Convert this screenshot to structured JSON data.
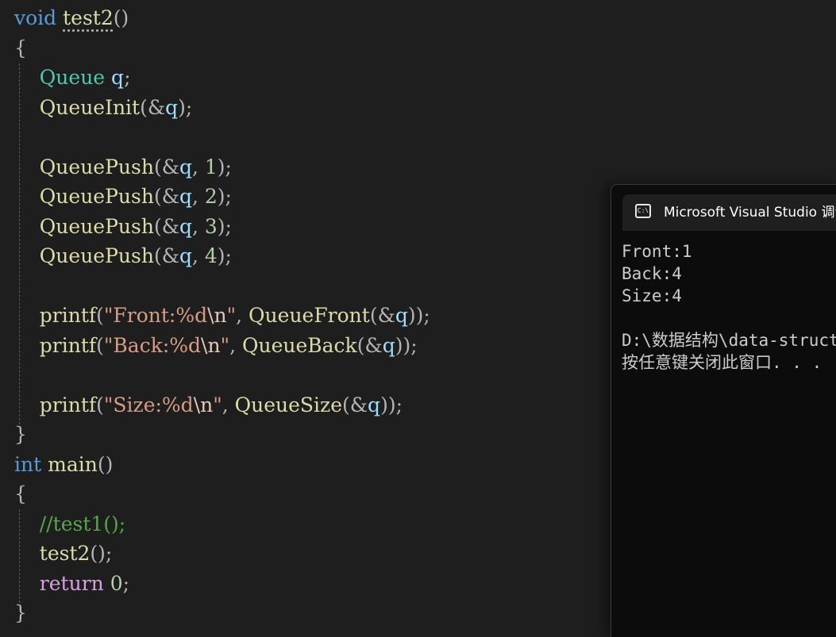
{
  "editor": {
    "lines": [
      {
        "tokens": [
          [
            "kw",
            "void"
          ],
          [
            "plain",
            " "
          ],
          [
            "fn squiggle",
            "test2"
          ],
          [
            "pun",
            "()"
          ]
        ]
      },
      {
        "tokens": [
          [
            "pun",
            "{"
          ]
        ]
      },
      {
        "tokens": [
          [
            "plain",
            "    "
          ],
          [
            "type",
            "Queue"
          ],
          [
            "plain",
            " "
          ],
          [
            "var",
            "q"
          ],
          [
            "pun",
            ";"
          ]
        ]
      },
      {
        "tokens": [
          [
            "plain",
            "    "
          ],
          [
            "fn",
            "QueueInit"
          ],
          [
            "pun",
            "(&"
          ],
          [
            "var",
            "q"
          ],
          [
            "pun",
            ");"
          ]
        ]
      },
      {
        "tokens": []
      },
      {
        "tokens": [
          [
            "plain",
            "    "
          ],
          [
            "fn",
            "QueuePush"
          ],
          [
            "pun",
            "(&"
          ],
          [
            "var",
            "q"
          ],
          [
            "pun",
            ", "
          ],
          [
            "num",
            "1"
          ],
          [
            "pun",
            ");"
          ]
        ]
      },
      {
        "tokens": [
          [
            "plain",
            "    "
          ],
          [
            "fn",
            "QueuePush"
          ],
          [
            "pun",
            "(&"
          ],
          [
            "var",
            "q"
          ],
          [
            "pun",
            ", "
          ],
          [
            "num",
            "2"
          ],
          [
            "pun",
            ");"
          ]
        ]
      },
      {
        "tokens": [
          [
            "plain",
            "    "
          ],
          [
            "fn",
            "QueuePush"
          ],
          [
            "pun",
            "(&"
          ],
          [
            "var",
            "q"
          ],
          [
            "pun",
            ", "
          ],
          [
            "num",
            "3"
          ],
          [
            "pun",
            ");"
          ]
        ]
      },
      {
        "tokens": [
          [
            "plain",
            "    "
          ],
          [
            "fn",
            "QueuePush"
          ],
          [
            "pun",
            "(&"
          ],
          [
            "var",
            "q"
          ],
          [
            "pun",
            ", "
          ],
          [
            "num",
            "4"
          ],
          [
            "pun",
            ");"
          ]
        ]
      },
      {
        "tokens": []
      },
      {
        "tokens": [
          [
            "plain",
            "    "
          ],
          [
            "fn",
            "printf"
          ],
          [
            "pun",
            "("
          ],
          [
            "str",
            "\"Front:%d"
          ],
          [
            "esc",
            "\\n"
          ],
          [
            "str",
            "\""
          ],
          [
            "pun",
            ", "
          ],
          [
            "fn",
            "QueueFront"
          ],
          [
            "pun",
            "(&"
          ],
          [
            "var",
            "q"
          ],
          [
            "pun",
            "));"
          ]
        ]
      },
      {
        "tokens": [
          [
            "plain",
            "    "
          ],
          [
            "fn",
            "printf"
          ],
          [
            "pun",
            "("
          ],
          [
            "str",
            "\"Back:%d"
          ],
          [
            "esc",
            "\\n"
          ],
          [
            "str",
            "\""
          ],
          [
            "pun",
            ", "
          ],
          [
            "fn",
            "QueueBack"
          ],
          [
            "pun",
            "(&"
          ],
          [
            "var",
            "q"
          ],
          [
            "pun",
            "));"
          ]
        ]
      },
      {
        "tokens": []
      },
      {
        "tokens": [
          [
            "plain",
            "    "
          ],
          [
            "fn",
            "printf"
          ],
          [
            "pun",
            "("
          ],
          [
            "str",
            "\"Size:%d"
          ],
          [
            "esc",
            "\\n"
          ],
          [
            "str",
            "\""
          ],
          [
            "pun",
            ", "
          ],
          [
            "fn",
            "QueueSize"
          ],
          [
            "pun",
            "(&"
          ],
          [
            "var",
            "q"
          ],
          [
            "pun",
            "));"
          ]
        ]
      },
      {
        "tokens": [
          [
            "pun",
            "}"
          ]
        ]
      },
      {
        "tokens": [
          [
            "kw",
            "int"
          ],
          [
            "plain",
            " "
          ],
          [
            "fn",
            "main"
          ],
          [
            "pun",
            "()"
          ]
        ]
      },
      {
        "tokens": [
          [
            "pun",
            "{"
          ]
        ]
      },
      {
        "tokens": [
          [
            "plain",
            "    "
          ],
          [
            "cmt",
            "//test1();"
          ]
        ]
      },
      {
        "tokens": [
          [
            "plain",
            "    "
          ],
          [
            "fn",
            "test2"
          ],
          [
            "pun",
            "();"
          ]
        ]
      },
      {
        "tokens": [
          [
            "plain",
            "    "
          ],
          [
            "kw2",
            "return"
          ],
          [
            "plain",
            " "
          ],
          [
            "num",
            "0"
          ],
          [
            "pun",
            ";"
          ]
        ]
      },
      {
        "tokens": [
          [
            "pun",
            "}"
          ]
        ]
      }
    ]
  },
  "console": {
    "icon_name": "console-icon",
    "icon_text": "C:\\",
    "title": "Microsoft Visual Studio 调试控制台",
    "output": [
      "Front:1",
      "Back:4",
      "Size:4",
      "",
      "D:\\数据结构\\data-structure",
      "按任意键关闭此窗口. . ."
    ]
  }
}
